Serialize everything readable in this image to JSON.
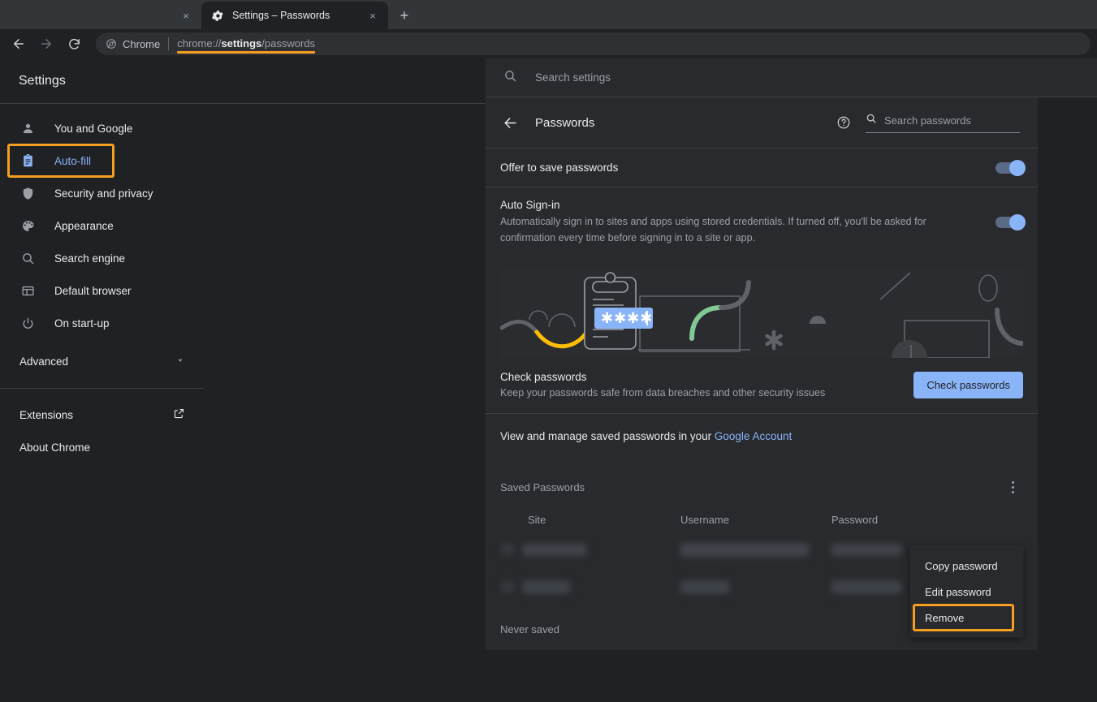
{
  "browser": {
    "tabs": [
      {
        "title": "",
        "favicon": "",
        "close_label": "×",
        "active": false
      },
      {
        "title": "Settings – Passwords",
        "favicon": "gear-icon",
        "close_label": "×",
        "active": true
      }
    ],
    "new_tab_label": "+",
    "nav": {
      "back": "←",
      "forward": "→",
      "reload": "⟳"
    },
    "omnibox": {
      "chip_label": "Chrome",
      "url_prefix": "chrome://",
      "url_bold": "settings",
      "url_suffix": "/passwords"
    }
  },
  "settings": {
    "title": "Settings",
    "search": {
      "placeholder": "Search settings",
      "value": ""
    },
    "nav_items": [
      {
        "label": "You and Google",
        "icon": "person-icon"
      },
      {
        "label": "Auto-fill",
        "icon": "clipboard-icon"
      },
      {
        "label": "Security and privacy",
        "icon": "shield-icon"
      },
      {
        "label": "Appearance",
        "icon": "palette-icon"
      },
      {
        "label": "Search engine",
        "icon": "search-icon"
      },
      {
        "label": "Default browser",
        "icon": "browser-window-icon"
      },
      {
        "label": "On start-up",
        "icon": "power-icon"
      }
    ],
    "advanced_label": "Advanced",
    "extensions_label": "Extensions",
    "about_label": "About Chrome"
  },
  "passwords": {
    "page_title": "Passwords",
    "search": {
      "placeholder": "Search passwords",
      "value": ""
    },
    "offer_to_save": {
      "label": "Offer to save passwords",
      "enabled": "on"
    },
    "auto_signin": {
      "label": "Auto Sign-in",
      "description": "Automatically sign in to sites and apps using stored credentials. If turned off, you'll be asked for confirmation every time before signing in to a site or app.",
      "enabled": "on"
    },
    "check": {
      "title": "Check passwords",
      "subtitle": "Keep your passwords safe from data breaches and other security issues",
      "button_label": "Check passwords"
    },
    "banner": {
      "password_field_text": "✱✱✱✱"
    },
    "manage_line": {
      "prefix": "View and manage saved passwords in your ",
      "link": "Google Account"
    },
    "saved": {
      "title": "Saved Passwords",
      "columns": [
        "Site",
        "Username",
        "Password"
      ],
      "rows": [
        {
          "site": "",
          "username": "",
          "password": "",
          "redacted": "true"
        },
        {
          "site": "",
          "username": "",
          "password": "",
          "redacted": "true"
        }
      ]
    },
    "never_saved_label": "Never saved",
    "context_menu": [
      {
        "label": "Copy password",
        "highlighted": "false"
      },
      {
        "label": "Edit password",
        "highlighted": "false"
      },
      {
        "label": "Remove",
        "highlighted": "true"
      }
    ]
  },
  "colors": {
    "accent_blue": "#8ab4f8",
    "highlight_orange": "#f59f20",
    "page_bg": "#202124",
    "card_bg": "#292a2d",
    "tabstrip_bg": "#323639"
  }
}
